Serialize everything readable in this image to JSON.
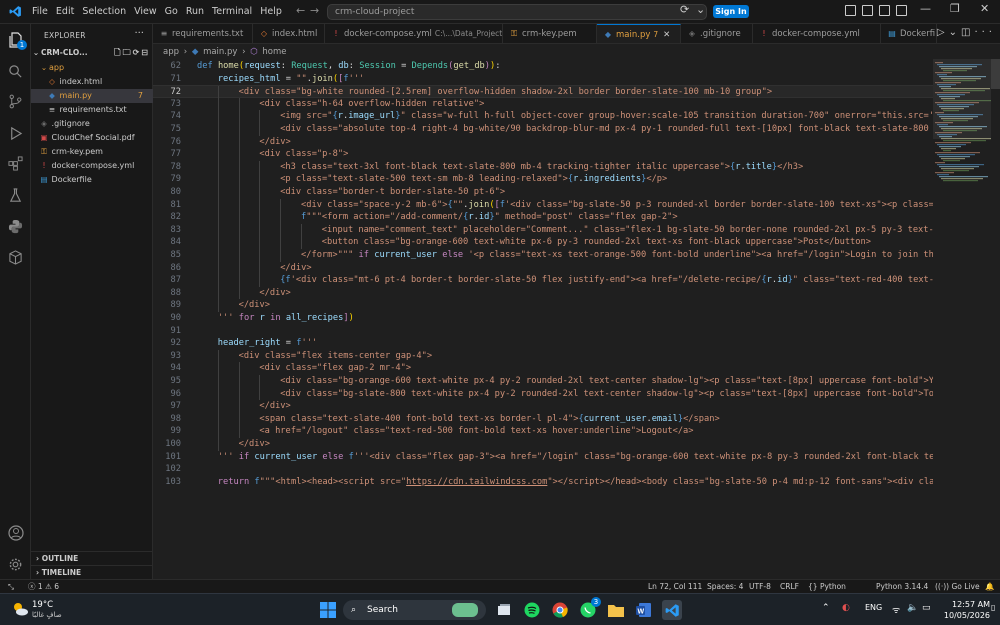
{
  "titlebar": {
    "menu": [
      "File",
      "Edit",
      "Selection",
      "View",
      "Go",
      "Run",
      "Terminal",
      "Help"
    ],
    "search_text": "crm-cloud-project",
    "signin_label": "Sign In"
  },
  "activitybar": {
    "explorer_badge": "1"
  },
  "sidebar": {
    "title": "EXPLORER",
    "root": "CRM-CLO...",
    "items": [
      {
        "label": "app",
        "type": "folder",
        "color": "#e2a03f"
      },
      {
        "label": "index.html",
        "type": "html",
        "color": "#cccccc"
      },
      {
        "label": "main.py",
        "type": "py",
        "color": "#e2a03f",
        "badge": "7"
      },
      {
        "label": "requirements.txt",
        "type": "txt",
        "color": "#cccccc"
      },
      {
        "label": ".gitignore",
        "type": "git",
        "color": "#cccccc"
      },
      {
        "label": "CloudChef Social.pdf",
        "type": "pdf",
        "color": "#cccccc"
      },
      {
        "label": "crm-key.pem",
        "type": "pem",
        "color": "#cccccc"
      },
      {
        "label": "docker-compose.yml",
        "type": "yml",
        "color": "#cccccc"
      },
      {
        "label": "Dockerfile",
        "type": "docker",
        "color": "#cccccc"
      }
    ],
    "outline": "OUTLINE",
    "timeline": "TIMELINE"
  },
  "tabs": [
    {
      "label": "requirements.txt",
      "desc": "",
      "icon": "txt"
    },
    {
      "label": "index.html",
      "desc": "",
      "icon": "html"
    },
    {
      "label": "docker-compose.yml",
      "desc": "C:\\...\\Data_Project",
      "icon": "yml"
    },
    {
      "label": "crm-key.pem",
      "desc": "",
      "icon": "pem"
    },
    {
      "label": "main.py",
      "desc": "7",
      "icon": "py",
      "active": true
    },
    {
      "label": ".gitignore",
      "desc": "",
      "icon": "git"
    },
    {
      "label": "docker-compose.yml",
      "desc": "",
      "icon": "yml"
    },
    {
      "label": "Dockerfi",
      "desc": "",
      "icon": "docker"
    }
  ],
  "breadcrumb": [
    "app",
    "main.py",
    "home"
  ],
  "code": {
    "lines": [
      {
        "n": "62",
        "indent": 0,
        "html": "<span class='kw'>def</span> <span class='fn'>home</span><span class='br'>(</span><span class='pr'>request</span><span class='op'>: </span><span class='ty'>Request</span><span class='op'>, </span><span class='pr'>db</span><span class='op'>: </span><span class='ty'>Session</span><span class='op'> = </span><span class='ty'>Depends</span><span class='cf'>(</span><span class='fn'>get_db</span><span class='cf'>)</span><span class='br'>)</span><span class='op'>:</span>"
      },
      {
        "n": "71",
        "indent": 1,
        "html": "<span class='va'>recipes_html</span><span class='op'> = </span><span class='st'>\"\"</span><span class='op'>.</span><span class='fn'>join</span><span class='br'>(</span><span class='cf'>[</span><span class='kw'>f</span><span class='st'>'''</span>"
      },
      {
        "n": "72",
        "indent": 2,
        "cur": true,
        "html": "<span class='st'>&lt;div class=\"bg-white rounded-[2.5rem] overflow-hidden shadow-2xl border border-slate-100 mb-10 group\"&gt;</span>"
      },
      {
        "n": "73",
        "indent": 3,
        "html": "<span class='st'>&lt;div class=\"h-64 overflow-hidden relative\"&gt;</span>"
      },
      {
        "n": "74",
        "indent": 4,
        "html": "<span class='st'>&lt;img src=\"</span><span class='kw'>{</span><span class='va'>r</span><span class='op'>.</span><span class='va'>image_url</span><span class='kw'>}</span><span class='st'>\" class=\"w-full h-full object-cover group-hover:scale-105 transition duration-700\" onerror=\"this.src='https</span>"
      },
      {
        "n": "75",
        "indent": 4,
        "html": "<span class='st'>&lt;div class=\"absolute top-4 right-4 bg-white/90 backdrop-blur-md px-4 py-1 rounded-full text-[10px] font-black text-slate-800 upper</span>"
      },
      {
        "n": "76",
        "indent": 3,
        "html": "<span class='st'>&lt;/div&gt;</span>"
      },
      {
        "n": "77",
        "indent": 3,
        "html": "<span class='st'>&lt;div class=\"p-8\"&gt;</span>"
      },
      {
        "n": "78",
        "indent": 4,
        "html": "<span class='st'>&lt;h3 class=\"text-3xl font-black text-slate-800 mb-4 tracking-tighter italic uppercase\"&gt;</span><span class='kw'>{</span><span class='va'>r</span><span class='op'>.</span><span class='va'>title</span><span class='kw'>}</span><span class='st'>&lt;/h3&gt;</span>"
      },
      {
        "n": "79",
        "indent": 4,
        "html": "<span class='st'>&lt;p class=\"text-slate-500 text-sm mb-8 leading-relaxed\"&gt;</span><span class='kw'>{</span><span class='va'>r</span><span class='op'>.</span><span class='va'>ingredients</span><span class='kw'>}</span><span class='st'>&lt;/p&gt;</span>"
      },
      {
        "n": "80",
        "indent": 4,
        "html": "<span class='st'>&lt;div class=\"border-t border-slate-50 pt-6\"&gt;</span>"
      },
      {
        "n": "81",
        "indent": 5,
        "html": "<span class='st'>&lt;div class=\"space-y-2 mb-6\"&gt;</span><span class='kw'>{</span><span class='st'>\"\"</span><span class='op'>.</span><span class='fn'>join</span><span class='br'>(</span><span class='cf'>[</span><span class='kw'>f</span><span class='st'>'&lt;div class=\"bg-slate-50 p-3 rounded-xl border border-slate-100 text-xs\"&gt;&lt;p class=\"font</span>"
      },
      {
        "n": "82",
        "indent": 5,
        "html": "<span class='kw'>f</span><span class='st'>\"\"\"&lt;form action=\"/add-comment/</span><span class='kw'>{</span><span class='va'>r</span><span class='op'>.</span><span class='va'>id</span><span class='kw'>}</span><span class='st'>\" method=\"post\" class=\"flex gap-2\"&gt;</span>"
      },
      {
        "n": "83",
        "indent": 6,
        "html": "<span class='st'>&lt;input name=\"comment_text\" placeholder=\"Comment...\" class=\"flex-1 bg-slate-50 border-none rounded-2xl px-5 py-3 text-xs ou</span>"
      },
      {
        "n": "84",
        "indent": 6,
        "html": "<span class='st'>&lt;button class=\"bg-orange-600 text-white px-6 py-3 rounded-2xl text-xs font-black uppercase\"&gt;Post&lt;/button&gt;</span>"
      },
      {
        "n": "85",
        "indent": 5,
        "html": "<span class='st'>&lt;/form&gt;\"\"\"</span><span class='cf'> if </span><span class='va'>current_user</span><span class='cf'> else </span><span class='st'>'&lt;p class=\"text-xs text-orange-500 font-bold underline\"&gt;&lt;a href=\"/login\"&gt;Login to join the com</span>"
      },
      {
        "n": "86",
        "indent": 4,
        "html": "<span class='st'>&lt;/div&gt;</span>"
      },
      {
        "n": "87",
        "indent": 4,
        "html": "<span class='kw'>{</span><span class='kw'>f</span><span class='st'>'&lt;div class=\"mt-6 pt-4 border-t border-slate-50 flex justify-end\"&gt;&lt;a href=\"/delete-recipe/</span><span class='kw'>{</span><span class='va'>r</span><span class='op'>.</span><span class='va'>id</span><span class='kw'>}</span><span class='st'>\" class=\"text-red-400 text-[10px</span>"
      },
      {
        "n": "88",
        "indent": 3,
        "html": "<span class='st'>&lt;/div&gt;</span>"
      },
      {
        "n": "89",
        "indent": 2,
        "html": "<span class='st'>&lt;/div&gt;</span>"
      },
      {
        "n": "90",
        "indent": 1,
        "html": "<span class='st'>'''</span><span class='cf'> for </span><span class='va'>r</span><span class='cf'> in </span><span class='va'>all_recipes</span><span class='cf'>]</span><span class='br'>)</span>"
      },
      {
        "n": "91",
        "indent": 0,
        "html": ""
      },
      {
        "n": "92",
        "indent": 1,
        "html": "<span class='va'>header_right</span><span class='op'> = </span><span class='kw'>f</span><span class='st'>'''</span>"
      },
      {
        "n": "93",
        "indent": 2,
        "html": "<span class='st'>&lt;div class=\"flex items-center gap-4\"&gt;</span>"
      },
      {
        "n": "94",
        "indent": 3,
        "html": "<span class='st'>&lt;div class=\"flex gap-2 mr-4\"&gt;</span>"
      },
      {
        "n": "95",
        "indent": 4,
        "html": "<span class='st'>&lt;div class=\"bg-orange-600 text-white px-4 py-2 rounded-2xl text-center shadow-lg\"&gt;&lt;p class=\"text-[8px] uppercase font-bold\"&gt;Your R</span>"
      },
      {
        "n": "96",
        "indent": 4,
        "html": "<span class='st'>&lt;div class=\"bg-slate-800 text-white px-4 py-2 rounded-2xl text-center shadow-lg\"&gt;&lt;p class=\"text-[8px] uppercase font-bold\"&gt;Total R</span>"
      },
      {
        "n": "97",
        "indent": 3,
        "html": "<span class='st'>&lt;/div&gt;</span>"
      },
      {
        "n": "98",
        "indent": 3,
        "html": "<span class='st'>&lt;span class=\"text-slate-400 font-bold text-xs border-l pl-4\"&gt;</span><span class='kw'>{</span><span class='va'>current_user</span><span class='op'>.</span><span class='va'>email</span><span class='kw'>}</span><span class='st'>&lt;/span&gt;</span>"
      },
      {
        "n": "99",
        "indent": 3,
        "html": "<span class='st'>&lt;a href=\"/logout\" class=\"text-red-500 font-bold text-xs hover:underline\"&gt;Logout&lt;/a&gt;</span>"
      },
      {
        "n": "100",
        "indent": 2,
        "html": "<span class='st'>&lt;/div&gt;</span>"
      },
      {
        "n": "101",
        "indent": 1,
        "html": "<span class='st'>'''</span><span class='cf'> if </span><span class='va'>current_user</span><span class='cf'> else </span><span class='kw'>f</span><span class='st'>'''&lt;div class=\"flex gap-3\"&gt;&lt;a href=\"/login\" class=\"bg-orange-600 text-white px-8 py-3 rounded-2xl font-black text-xs</span>"
      },
      {
        "n": "102",
        "indent": 0,
        "html": ""
      },
      {
        "n": "103",
        "indent": 1,
        "html": "<span class='cf'>return</span><span class='kw'> f</span><span class='st'>\"\"\"&lt;html&gt;&lt;head&gt;&lt;script src=\"<u>https://cdn.tailwindcss.com</u>\"&gt;&lt;/script&gt;&lt;/head&gt;&lt;body class=\"bg-slate-50 p-4 md:p-12 font-sans\"&gt;&lt;div class=\"m</span>"
      }
    ]
  },
  "statusbar": {
    "errors": "1",
    "warnings": "6",
    "position": "Ln 72, Col 111",
    "spaces": "Spaces: 4",
    "encoding": "UTF-8",
    "eol": "CRLF",
    "language": "Python",
    "interpreter": "Python 3.14.4",
    "golive": "Go Live"
  },
  "taskbar": {
    "temp": "19°C",
    "weather_desc": "صافٍ غالبًا",
    "search_label": "Search",
    "lang": "ENG",
    "time": "12:57 AM",
    "date": "10/05/2026",
    "notif_badge": "3"
  },
  "colors": {
    "accent": "#0078d4",
    "bg": "#1f1f1f",
    "sidebar": "#181818"
  }
}
